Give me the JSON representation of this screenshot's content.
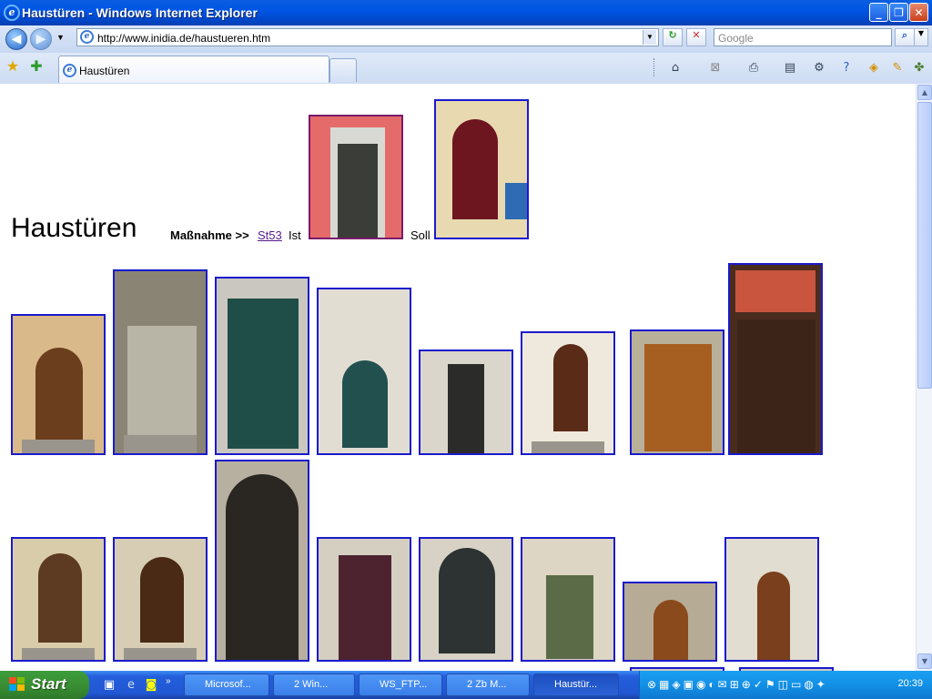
{
  "window": {
    "title": "Haustüren - Windows Internet Explorer"
  },
  "address_bar": {
    "url": "http://www.inidia.de/haustueren.htm"
  },
  "search": {
    "placeholder": "Google"
  },
  "tab": {
    "title": "Haustüren"
  },
  "page": {
    "heading": "Haustüren",
    "breadcrumb_label": "Maßnahme >>",
    "breadcrumb_link": "St53",
    "ist_label": "Ist",
    "soll_label": "Soll"
  },
  "taskbar": {
    "start_label": "Start",
    "buttons": [
      "Microsof...",
      "2 Win...",
      "WS_FTP...",
      "2 Zb M...",
      "Haustür..."
    ],
    "clock": "20:39"
  },
  "icons": {
    "ie": "internet-explorer-icon",
    "back": "back-arrow-icon",
    "forward": "forward-arrow-icon",
    "refresh": "refresh-icon",
    "stop": "stop-icon",
    "search": "magnifier-icon",
    "favorites": "star-icon",
    "add_favorites": "add-favorite-icon",
    "home": "home-icon",
    "feeds": "rss-icon",
    "print": "printer-icon",
    "page": "page-icon",
    "tools": "gear-icon",
    "help": "help-icon",
    "research": "research-icon",
    "messenger": "messenger-icon"
  },
  "colors": {
    "image_border": "#1a1acd",
    "link": "#551a8b"
  }
}
